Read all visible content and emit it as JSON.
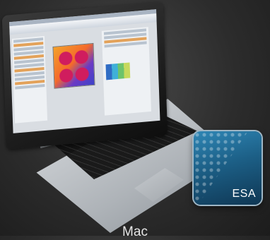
{
  "icon": {
    "label": "ESA",
    "name": "esa-app-icon"
  },
  "caption": "Mac",
  "colors": {
    "background": "#2c2c2c",
    "icon_blue": "#1c5f86",
    "heatmap_magenta": "#d01d5e",
    "heatmap_orange": "#f46a2b"
  }
}
